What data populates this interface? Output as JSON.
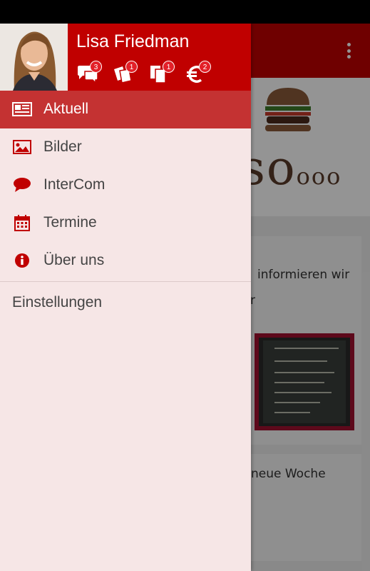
{
  "user": {
    "name": "Lisa Friedman"
  },
  "counters": [
    {
      "icon": "chat-bubbles-icon",
      "count": "3"
    },
    {
      "icon": "tickets-icon",
      "count": "1"
    },
    {
      "icon": "documents-icon",
      "count": "1"
    },
    {
      "icon": "euro-icon",
      "count": "2"
    }
  ],
  "menu": [
    {
      "icon": "newspaper-icon",
      "label": "Aktuell",
      "active": true
    },
    {
      "icon": "image-icon",
      "label": "Bilder",
      "active": false
    },
    {
      "icon": "chat-icon",
      "label": "InterCom",
      "active": false
    },
    {
      "icon": "calendar-icon",
      "label": "Termine",
      "active": false
    },
    {
      "icon": "info-icon",
      "label": "Über uns",
      "active": false
    }
  ],
  "settings": {
    "label": "Einstellungen"
  },
  "background": {
    "banner_text": "so",
    "banner_suffix": "ooo",
    "card_text": "informieren wir",
    "card_text2": "r",
    "card2_text": "neue Woche"
  },
  "colors": {
    "primary": "#c00000",
    "active_item": "#c43232",
    "drawer_bg": "#f6e6e6",
    "badge": "#e32028"
  }
}
